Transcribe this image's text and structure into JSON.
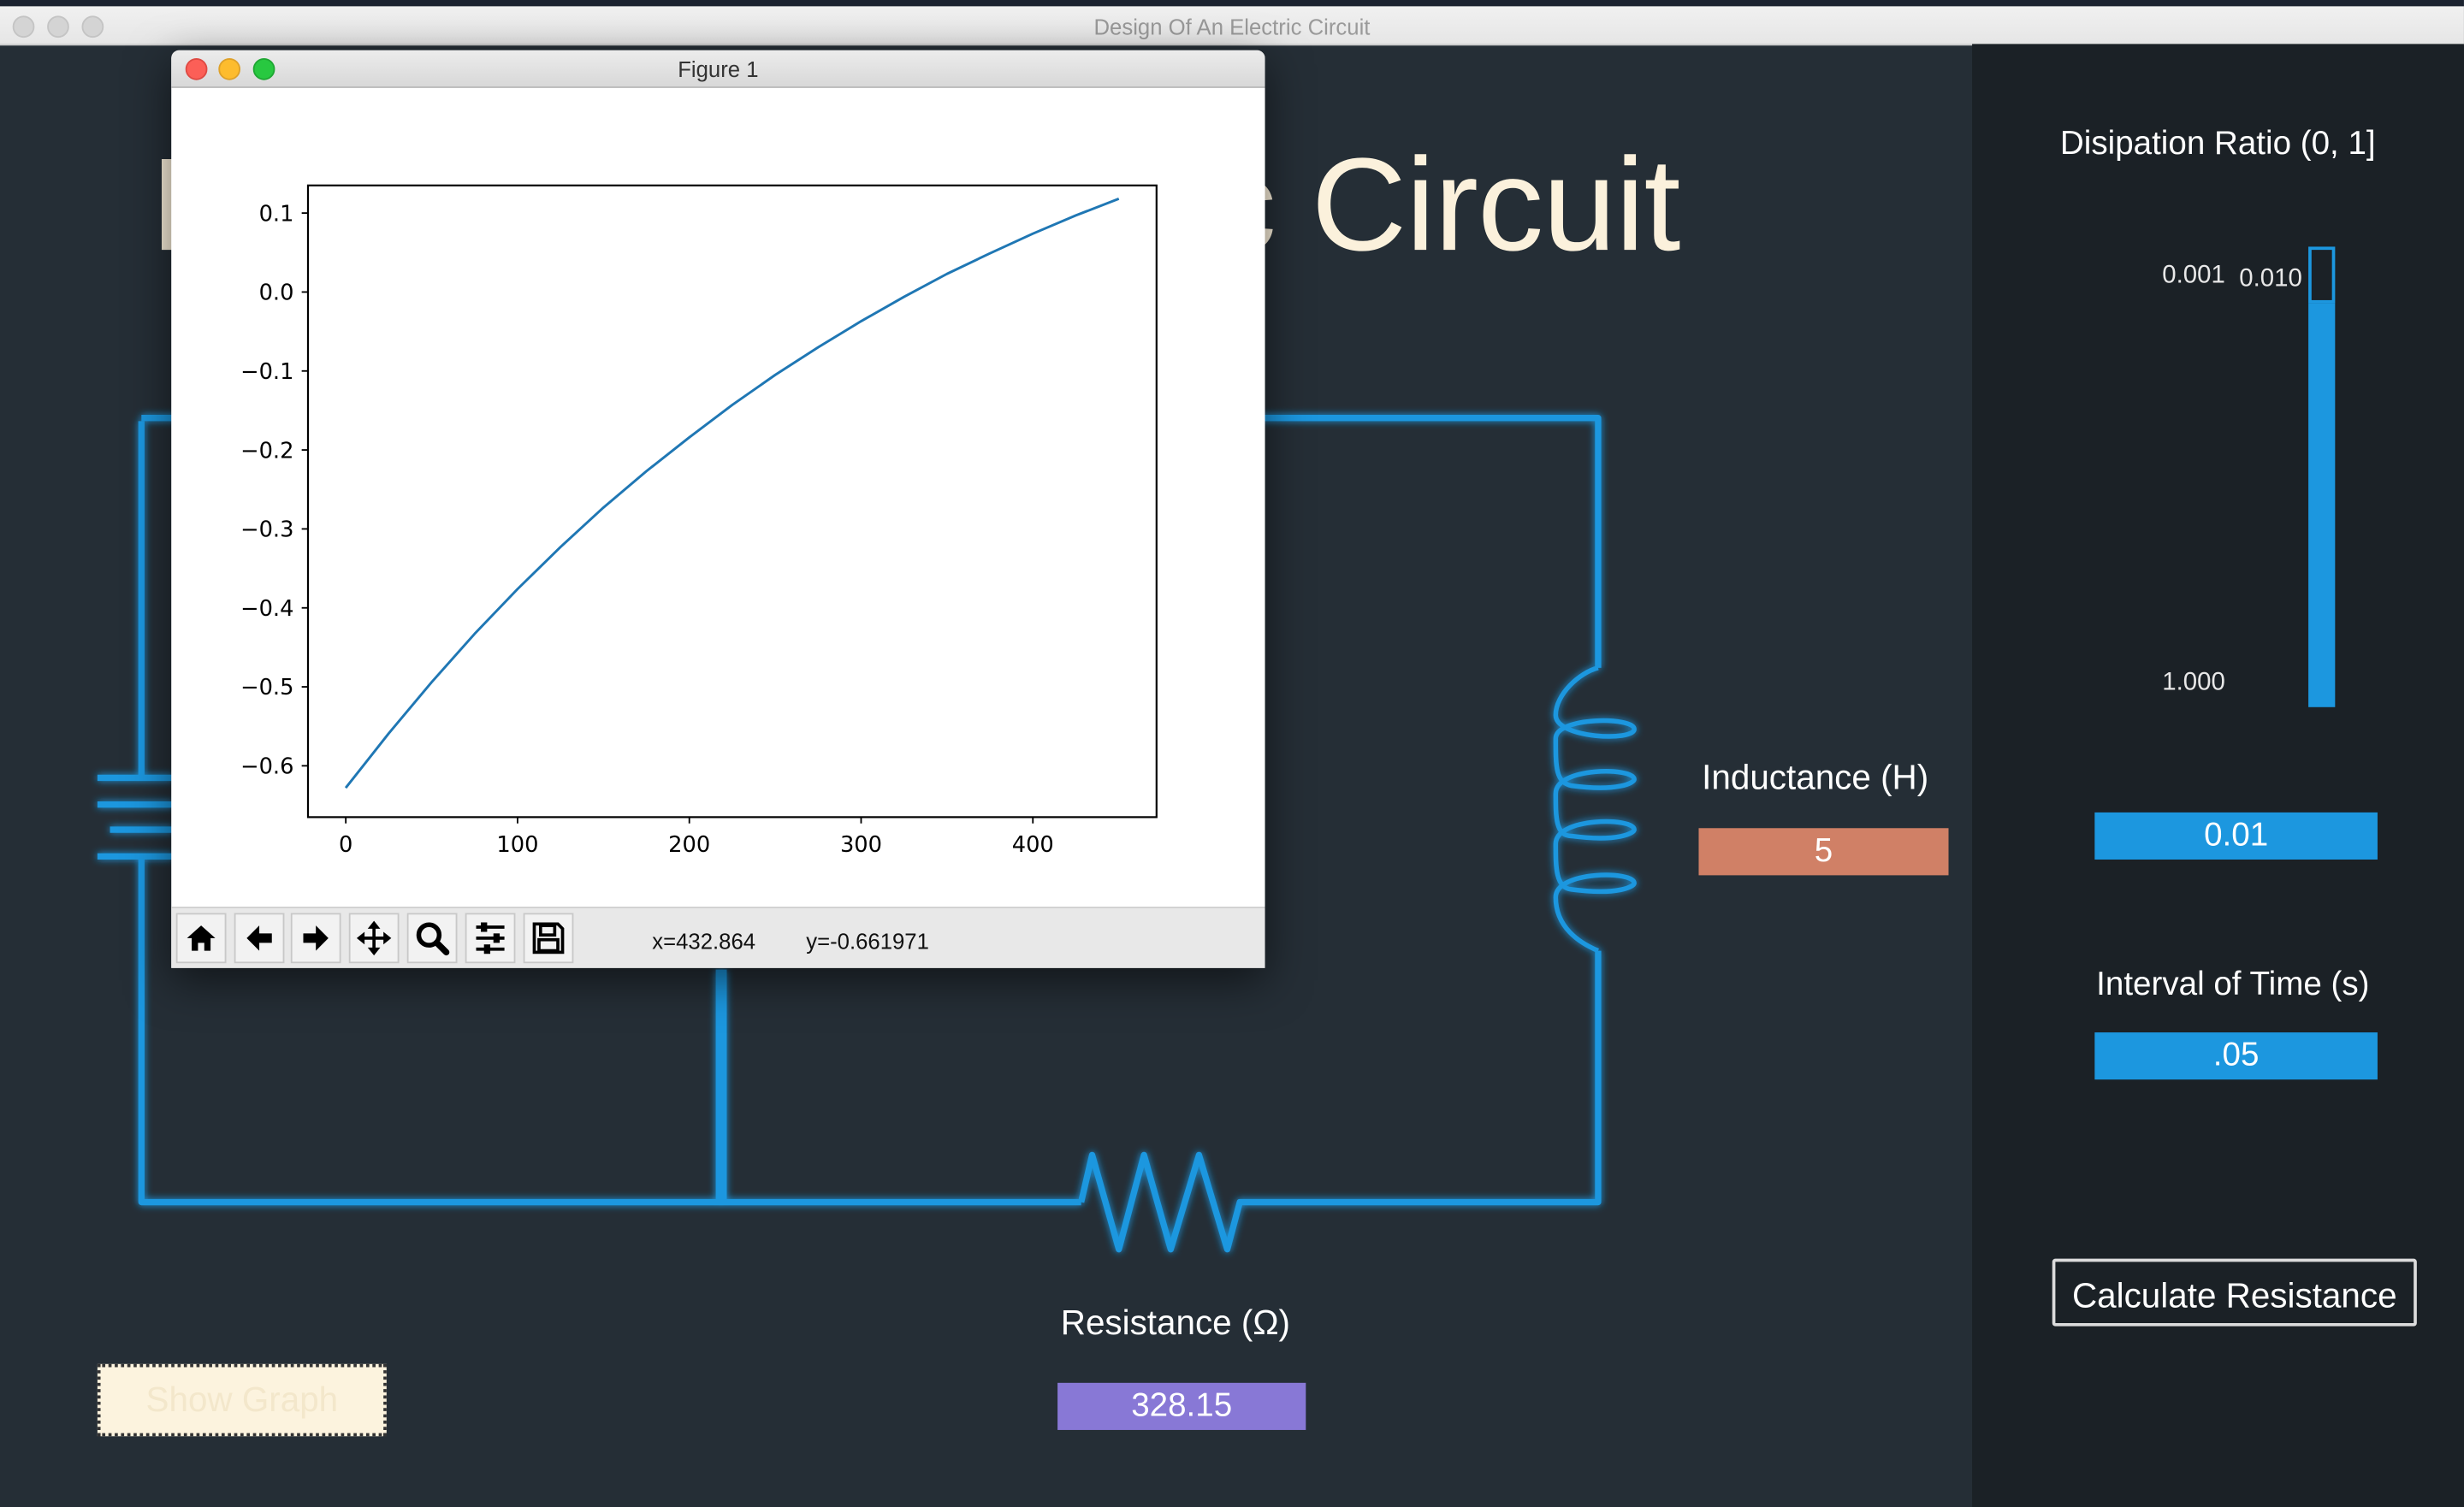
{
  "window": {
    "title": "Design Of An Electric Circuit"
  },
  "main": {
    "heading_left": "D",
    "heading_right": "c Circuit"
  },
  "inductance": {
    "label": "Inductance (H)",
    "value": "5",
    "color": "#d08066"
  },
  "resistance": {
    "label": "Resistance (Ω)",
    "value": "328.15",
    "color": "#8878d6"
  },
  "dissipation": {
    "label": "Disipation Ratio (0, 1]",
    "ticks": [
      "0.001",
      "0.010",
      "1.000"
    ],
    "value": "0.01",
    "color": "#1c97df"
  },
  "interval": {
    "label": "Interval of Time (s)",
    "value": ".05"
  },
  "buttons": {
    "calculate": "Calculate Resistance",
    "show_graph": "Show Graph"
  },
  "figure": {
    "title": "Figure 1",
    "toolbar_icons": [
      "home-icon",
      "back-arrow-icon",
      "forward-arrow-icon",
      "pan-icon",
      "zoom-icon",
      "configure-subplots-icon",
      "save-icon"
    ],
    "coords": {
      "x": "x=432.864",
      "y": "y=-0.661971"
    }
  },
  "chart_data": {
    "type": "line",
    "title": "",
    "xlabel": "",
    "ylabel": "",
    "xlim": [
      -22,
      472
    ],
    "ylim": [
      -0.665,
      0.135
    ],
    "xticks": [
      0,
      100,
      200,
      300,
      400
    ],
    "yticks": [
      0.1,
      0.0,
      -0.1,
      -0.2,
      -0.3,
      -0.4,
      -0.5,
      -0.6
    ],
    "ytick_labels": [
      "0.1",
      "0.0",
      "−0.1",
      "−0.2",
      "−0.3",
      "−0.4",
      "−0.5",
      "−0.6"
    ],
    "grid": false,
    "series": [
      {
        "color": "#1f77b4",
        "x": [
          0,
          25,
          50,
          75,
          100,
          125,
          150,
          175,
          200,
          225,
          250,
          275,
          300,
          325,
          350,
          375,
          400,
          425,
          450
        ],
        "y": [
          -0.628,
          -0.559,
          -0.494,
          -0.433,
          -0.376,
          -0.323,
          -0.273,
          -0.227,
          -0.184,
          -0.143,
          -0.105,
          -0.07,
          -0.037,
          -0.006,
          0.023,
          0.049,
          0.074,
          0.097,
          0.118
        ]
      }
    ]
  }
}
